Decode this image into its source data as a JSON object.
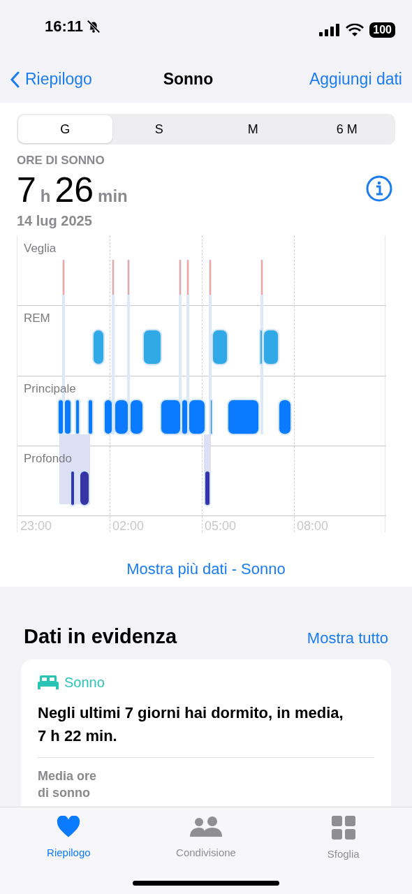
{
  "status_bar": {
    "time": "16:11",
    "battery": "100"
  },
  "nav": {
    "back": "Riepilogo",
    "title": "Sonno",
    "action": "Aggiungi dati"
  },
  "segments": [
    {
      "label": "G",
      "selected": true
    },
    {
      "label": "S",
      "selected": false
    },
    {
      "label": "M",
      "selected": false
    },
    {
      "label": "6 M",
      "selected": false
    }
  ],
  "summary": {
    "label": "ORE DI SONNO",
    "hours": "7",
    "hours_unit": "h",
    "minutes": "26",
    "minutes_unit": "min",
    "date": "14 lug 2025"
  },
  "hypnogram": {
    "stages": [
      "Veglia",
      "REM",
      "Principale",
      "Profondo"
    ],
    "times": [
      "23:00",
      "02:00",
      "05:00",
      "08:00"
    ]
  },
  "more_link": "Mostra più dati - Sonno",
  "highlights": {
    "title": "Dati in evidenza",
    "show_all": "Mostra tutto",
    "card": {
      "category": "Sonno",
      "text": "Negli ultimi 7 giorni hai dormito, in media, 7 h 22 min.",
      "metric_label": "Media ore di sonno"
    }
  },
  "tab_bar": [
    {
      "label": "Riepilogo",
      "selected": true
    },
    {
      "label": "Condivisione",
      "selected": false
    },
    {
      "label": "Sfoglia",
      "selected": false
    }
  ]
}
